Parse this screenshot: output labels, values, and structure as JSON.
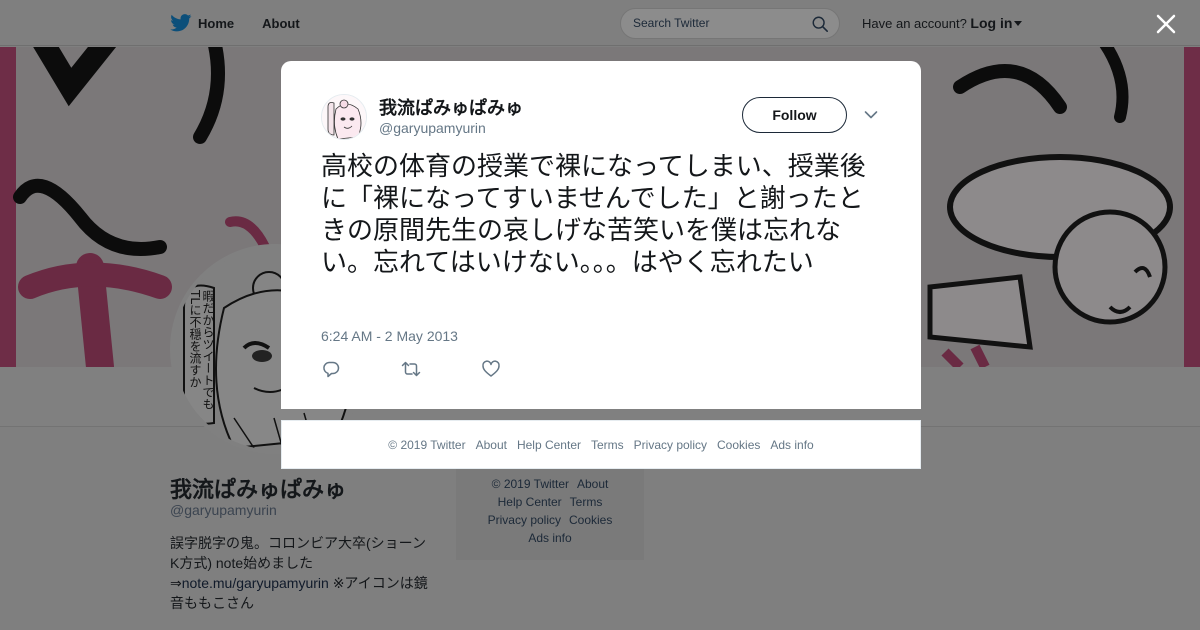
{
  "nav": {
    "home_label": "Home",
    "about_label": "About",
    "search_placeholder": "Search Twitter",
    "have_account": "Have an account?",
    "login_label": "Log in"
  },
  "profile": {
    "name": "我流ぱみゅぱみゅ",
    "handle": "@garyupamyurin",
    "bio_text_1": "誤字脱字の鬼。コロンビア大卒(ショーンK方式) note始めました",
    "bio_arrow": "⇒",
    "bio_link": "note.mu/garyupamyurin",
    "bio_text_2": " ※アイコンは鏡音ももこさん",
    "avatar_caption": "暇だからツイートでもTLに不穏を流すか"
  },
  "background_footer": {
    "items": [
      "© 2019 Twitter",
      "About",
      "Help Center",
      "Terms",
      "Privacy policy",
      "Cookies",
      "Ads info"
    ]
  },
  "tweet": {
    "author_name": "我流ぱみゅぱみゅ",
    "author_handle": "@garyupamyurin",
    "follow_label": "Follow",
    "text": "高校の体育の授業で裸になってしまい、授業後に「裸になってすいませんでした」と謝ったときの原間先生の哀しげな苦笑いを僕は忘れない。忘れてはいけない。。。はやく忘れたい",
    "timestamp": "6:24 AM - 2 May 2013"
  },
  "modal_footer": {
    "items": [
      "© 2019 Twitter",
      "About",
      "Help Center",
      "Terms",
      "Privacy policy",
      "Cookies",
      "Ads info"
    ]
  },
  "icons": {
    "brand": "twitter-bird-icon",
    "search": "search-icon",
    "close": "close-icon",
    "reply": "reply-icon",
    "retweet": "retweet-icon",
    "like": "heart-icon",
    "more": "chevron-down-icon"
  },
  "colors": {
    "brand_blue": "#1da1f2",
    "banner_pink": "#c7356e",
    "overlay": "#7f7f7f"
  }
}
